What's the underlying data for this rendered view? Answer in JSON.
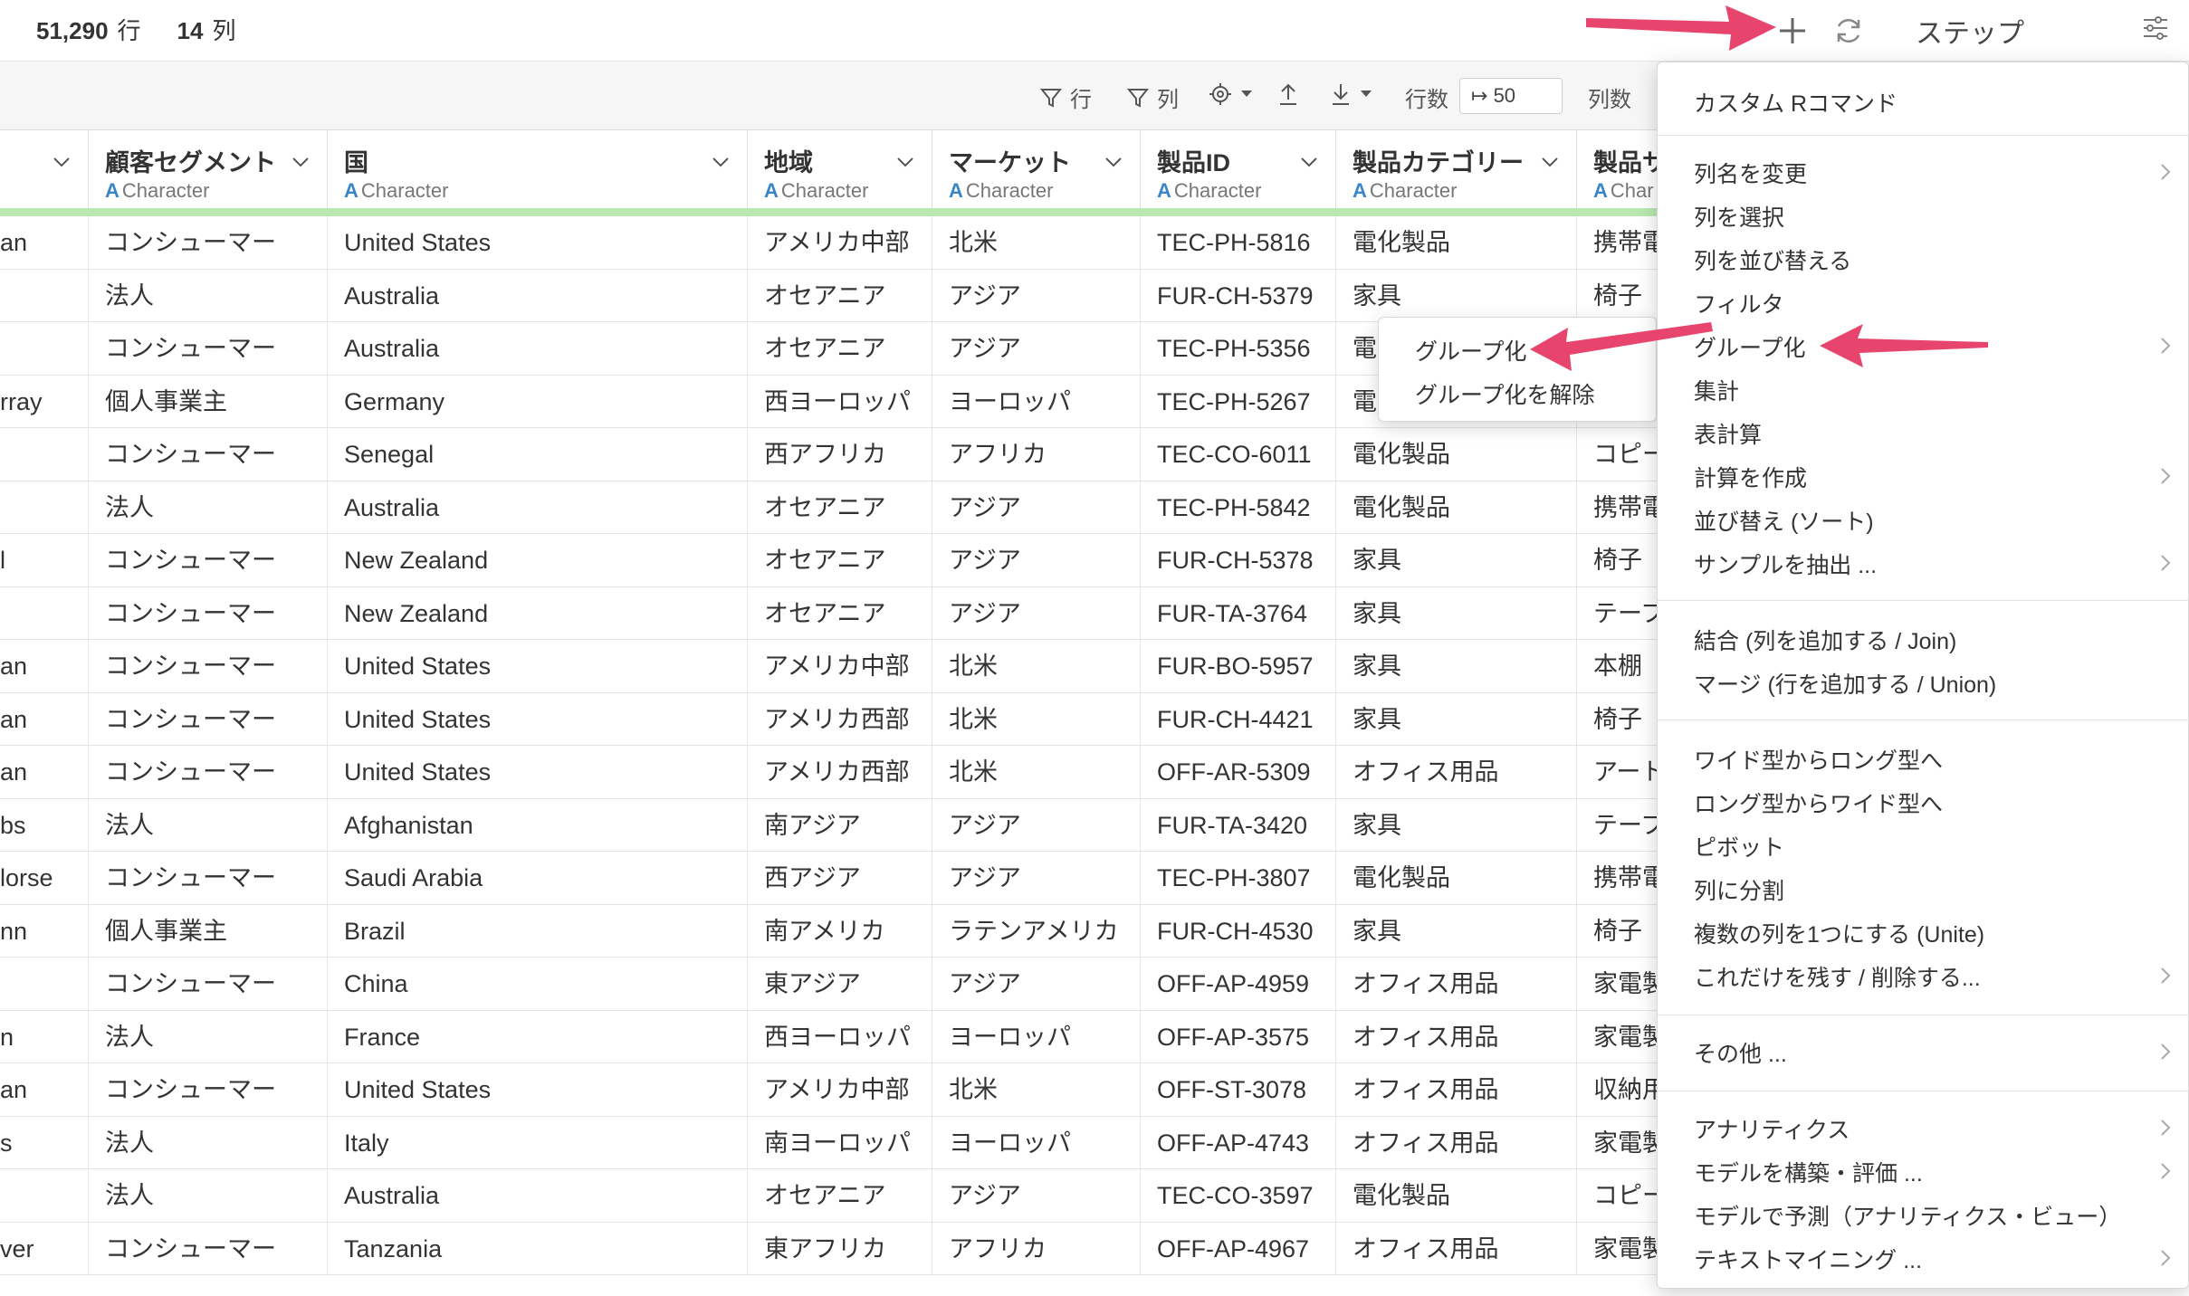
{
  "summary": {
    "rows_value": "51,290",
    "rows_unit": "行",
    "cols_value": "14",
    "cols_unit": "列"
  },
  "topbar": {
    "step_label": "ステップ",
    "add_icon": "plus-icon",
    "refresh_icon": "refresh-icon",
    "settings_icon": "sliders-icon"
  },
  "toolbar": {
    "filter_row": "行",
    "filter_col": "列",
    "rows_label": "行数",
    "rows_value": "50",
    "cols_label": "列数"
  },
  "columns": [
    {
      "name": "",
      "type": ""
    },
    {
      "name": "顧客セグメント",
      "type": "Character"
    },
    {
      "name": "国",
      "type": "Character"
    },
    {
      "name": "地域",
      "type": "Character"
    },
    {
      "name": "マーケット",
      "type": "Character"
    },
    {
      "name": "製品ID",
      "type": "Character"
    },
    {
      "name": "製品カテゴリー",
      "type": "Character"
    },
    {
      "name": "製品サ",
      "type": "Char"
    }
  ],
  "type_letter": "A",
  "rows": [
    [
      "an",
      "コンシューマー",
      "United States",
      "アメリカ中部",
      "北米",
      "TEC-PH-5816",
      "電化製品",
      "携帯電"
    ],
    [
      "",
      "法人",
      "Australia",
      "オセアニア",
      "アジア",
      "FUR-CH-5379",
      "家具",
      "椅子"
    ],
    [
      "",
      "コンシューマー",
      "Australia",
      "オセアニア",
      "アジア",
      "TEC-PH-5356",
      "電",
      ""
    ],
    [
      "rray",
      "個人事業主",
      "Germany",
      "西ヨーロッパ",
      "ヨーロッパ",
      "TEC-PH-5267",
      "電",
      ""
    ],
    [
      "",
      "コンシューマー",
      "Senegal",
      "西アフリカ",
      "アフリカ",
      "TEC-CO-6011",
      "電化製品",
      "コピー"
    ],
    [
      "",
      "法人",
      "Australia",
      "オセアニア",
      "アジア",
      "TEC-PH-5842",
      "電化製品",
      "携帯電"
    ],
    [
      "l",
      "コンシューマー",
      "New Zealand",
      "オセアニア",
      "アジア",
      "FUR-CH-5378",
      "家具",
      "椅子"
    ],
    [
      "",
      "コンシューマー",
      "New Zealand",
      "オセアニア",
      "アジア",
      "FUR-TA-3764",
      "家具",
      "テーブ"
    ],
    [
      "an",
      "コンシューマー",
      "United States",
      "アメリカ中部",
      "北米",
      "FUR-BO-5957",
      "家具",
      "本棚"
    ],
    [
      "an",
      "コンシューマー",
      "United States",
      "アメリカ西部",
      "北米",
      "FUR-CH-4421",
      "家具",
      "椅子"
    ],
    [
      "an",
      "コンシューマー",
      "United States",
      "アメリカ西部",
      "北米",
      "OFF-AR-5309",
      "オフィス用品",
      "アート"
    ],
    [
      "bs",
      "法人",
      "Afghanistan",
      "南アジア",
      "アジア",
      "FUR-TA-3420",
      "家具",
      "テーブ"
    ],
    [
      "lorse",
      "コンシューマー",
      "Saudi Arabia",
      "西アジア",
      "アジア",
      "TEC-PH-3807",
      "電化製品",
      "携帯電"
    ],
    [
      "nn",
      "個人事業主",
      "Brazil",
      "南アメリカ",
      "ラテンアメリカ",
      "FUR-CH-4530",
      "家具",
      "椅子"
    ],
    [
      "",
      "コンシューマー",
      "China",
      "東アジア",
      "アジア",
      "OFF-AP-4959",
      "オフィス用品",
      "家電製"
    ],
    [
      "n",
      "法人",
      "France",
      "西ヨーロッパ",
      "ヨーロッパ",
      "OFF-AP-3575",
      "オフィス用品",
      "家電製"
    ],
    [
      "an",
      "コンシューマー",
      "United States",
      "アメリカ中部",
      "北米",
      "OFF-ST-3078",
      "オフィス用品",
      "収納用"
    ],
    [
      "s",
      "法人",
      "Italy",
      "南ヨーロッパ",
      "ヨーロッパ",
      "OFF-AP-4743",
      "オフィス用品",
      "家電製"
    ],
    [
      "",
      "法人",
      "Australia",
      "オセアニア",
      "アジア",
      "TEC-CO-3597",
      "電化製品",
      "コピー"
    ],
    [
      "ver",
      "コンシューマー",
      "Tanzania",
      "東アフリカ",
      "アフリカ",
      "OFF-AP-4967",
      "オフィス用品",
      "家電製"
    ]
  ],
  "menu": {
    "custom_r": "カスタム Rコマンド",
    "rename": "列名を変更",
    "select": "列を選択",
    "reorder": "列を並び替える",
    "filter": "フィルタ",
    "group": "グループ化",
    "summarize": "集計",
    "table_calc": "表計算",
    "create_calc": "計算を作成",
    "sort": "並び替え (ソート)",
    "sample": "サンプルを抽出 ...",
    "join": "結合 (列を追加する / Join)",
    "union": "マージ (行を追加する / Union)",
    "wide_to_long": "ワイド型からロング型へ",
    "long_to_wide": "ロング型からワイド型へ",
    "pivot": "ピボット",
    "split": "列に分割",
    "unite": "複数の列を1つにする (Unite)",
    "keep_remove": "これだけを残す / 削除する...",
    "other": "その他 ...",
    "analytics": "アナリティクス",
    "build_model": "モデルを構築・評価 ...",
    "predict": "モデルで予測（アナリティクス・ビュー）",
    "text_mining": "テキストマイニング ..."
  },
  "submenu": {
    "group": "グループ化",
    "ungroup": "グループ化を解除"
  },
  "colors": {
    "accent_arrow": "#e8456e",
    "type_letter": "#3a86c8",
    "green_bar": "#b9e8b0"
  }
}
